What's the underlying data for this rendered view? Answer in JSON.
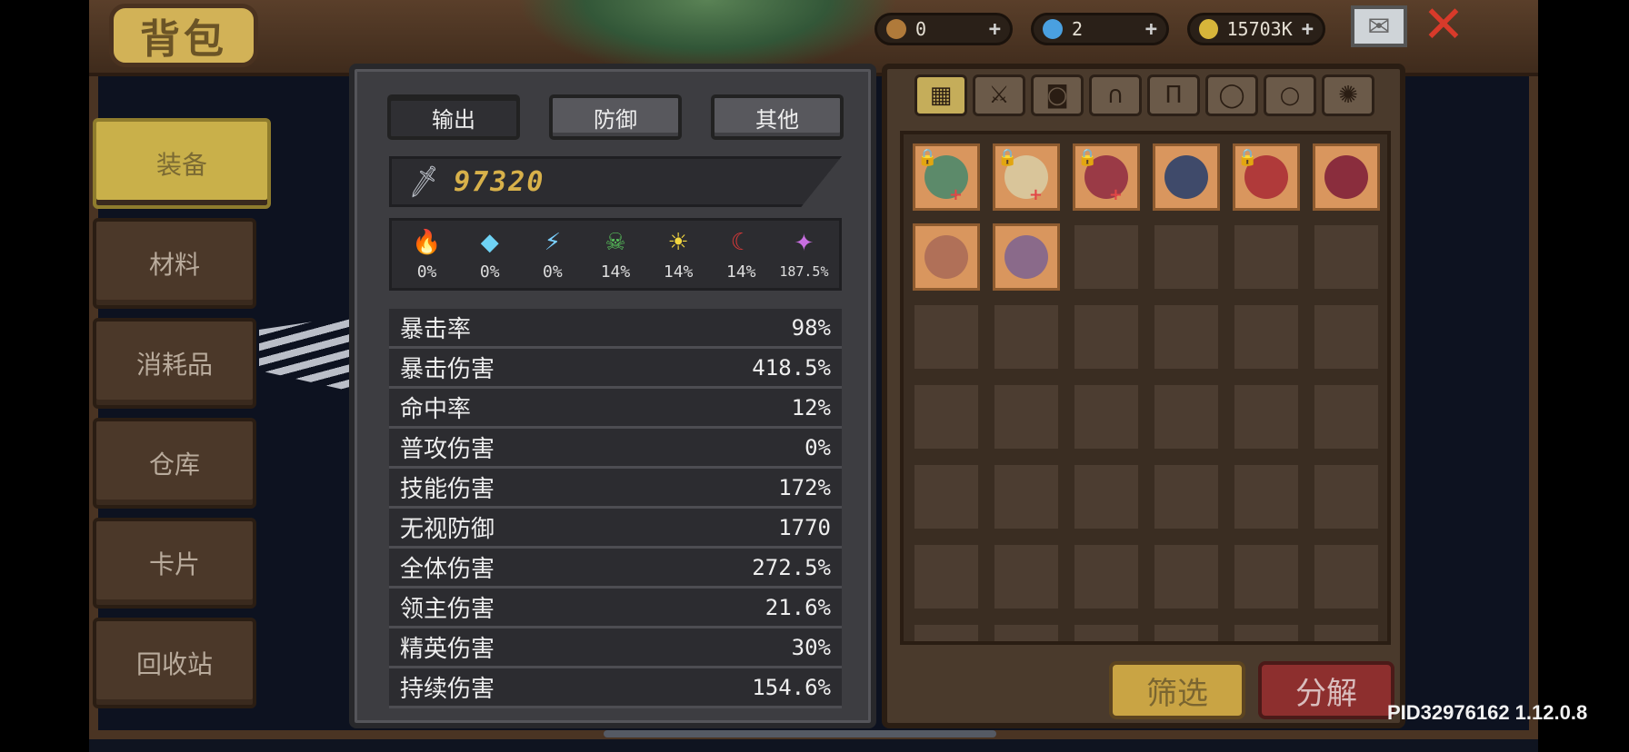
{
  "title": "背包",
  "currency": [
    {
      "icon": "feather-currency-icon",
      "value": "0",
      "color": "#b07a3a"
    },
    {
      "icon": "gem-currency-icon",
      "value": "2",
      "color": "#4aa0e0"
    },
    {
      "icon": "coin-icon",
      "value": "15703K",
      "color": "#d7b53a"
    }
  ],
  "sidebar": {
    "items": [
      {
        "label": "装备",
        "active": true
      },
      {
        "label": "材料"
      },
      {
        "label": "消耗品"
      },
      {
        "label": "仓库"
      },
      {
        "label": "卡片"
      },
      {
        "label": "回收站"
      }
    ]
  },
  "stats_panel": {
    "tabs": [
      {
        "label": "输出",
        "active": true
      },
      {
        "label": "防御"
      },
      {
        "label": "其他"
      }
    ],
    "power": "97320",
    "elements": [
      {
        "icon": "fire-icon",
        "glyph": "🔥",
        "value": "0%",
        "color": "#f07a2a"
      },
      {
        "icon": "ice-crystal-icon",
        "glyph": "◆",
        "value": "0%",
        "color": "#6fd3f5"
      },
      {
        "icon": "lightning-icon",
        "glyph": "⚡",
        "value": "0%",
        "color": "#7ad0ff"
      },
      {
        "icon": "poison-skull-icon",
        "glyph": "☠",
        "value": "14%",
        "color": "#57c05a"
      },
      {
        "icon": "holy-sun-icon",
        "glyph": "☀",
        "value": "14%",
        "color": "#f2d640"
      },
      {
        "icon": "dark-moon-icon",
        "glyph": "☾",
        "value": "14%",
        "color": "#d83838"
      },
      {
        "icon": "arcane-icon",
        "glyph": "✦",
        "value": "187.5%",
        "color": "#c86ee0"
      }
    ],
    "rows": [
      {
        "label": "暴击率",
        "value": "98%"
      },
      {
        "label": "暴击伤害",
        "value": "418.5%"
      },
      {
        "label": "命中率",
        "value": "12%"
      },
      {
        "label": "普攻伤害",
        "value": "0%"
      },
      {
        "label": "技能伤害",
        "value": "172%"
      },
      {
        "label": "无视防御",
        "value": "1770"
      },
      {
        "label": "全体伤害",
        "value": "272.5%"
      },
      {
        "label": "领主伤害",
        "value": "21.6%"
      },
      {
        "label": "精英伤害",
        "value": "30%"
      },
      {
        "label": "持续伤害",
        "value": "154.6%"
      }
    ]
  },
  "inventory": {
    "filters": [
      {
        "icon": "all-grid-icon",
        "glyph": "▦"
      },
      {
        "icon": "weapon-sword-icon",
        "glyph": "⚔"
      },
      {
        "icon": "armor-icon",
        "glyph": "◙"
      },
      {
        "icon": "helmet-icon",
        "glyph": "∩"
      },
      {
        "icon": "pants-icon",
        "glyph": "Π"
      },
      {
        "icon": "necklace-icon",
        "glyph": "◯"
      },
      {
        "icon": "ring-icon",
        "glyph": "○"
      },
      {
        "icon": "gear-icon",
        "glyph": "✺"
      }
    ],
    "items": [
      {
        "name": "weapon-item",
        "color": "#5c8a6a",
        "locked": true,
        "plus": true
      },
      {
        "name": "wing-item",
        "color": "#d9c59a",
        "locked": true,
        "plus": true
      },
      {
        "name": "red-armor-item",
        "color": "#9a3a46",
        "locked": true,
        "plus": true
      },
      {
        "name": "dark-armor-item",
        "color": "#3f4a6a",
        "locked": false,
        "plus": false
      },
      {
        "name": "amulet-item",
        "color": "#b03a3a",
        "locked": true,
        "plus": false
      },
      {
        "name": "beetle-item",
        "color": "#8a2d3d",
        "locked": false,
        "plus": false
      },
      {
        "name": "ring-item",
        "color": "#b07058",
        "locked": false,
        "plus": false
      },
      {
        "name": "stone-item",
        "color": "#8a6a8a",
        "locked": false,
        "plus": false
      }
    ],
    "empty_slots": 34,
    "filter_button": "筛选",
    "dismantle_button": "分解"
  },
  "footer_id": "PID32976162 1.12.0.8"
}
